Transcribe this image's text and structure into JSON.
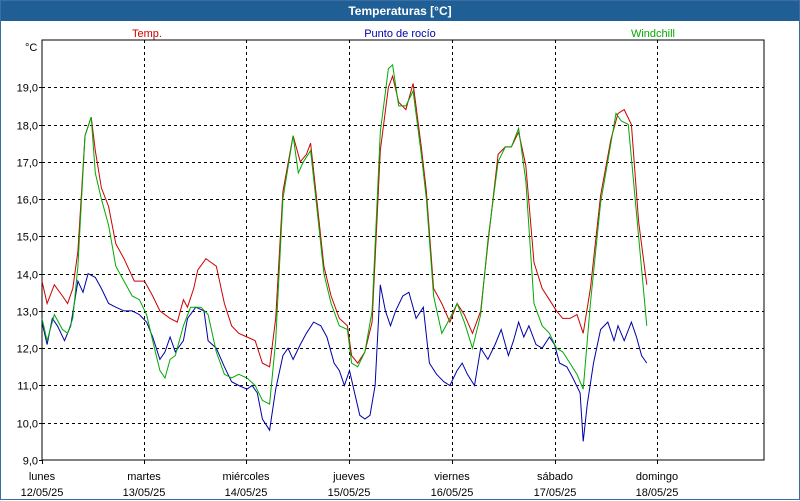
{
  "window": {
    "title": "Temperaturas [°C]"
  },
  "chart_data": {
    "type": "line",
    "title": "Temperaturas [°C]",
    "ylabel": "°C",
    "ylim": [
      9.0,
      20.0
    ],
    "y_ticks": [
      "19,0",
      "18,0",
      "17,0",
      "16,0",
      "15,0",
      "14,0",
      "13,0",
      "12,0",
      "11,0",
      "10,0",
      "9,0"
    ],
    "x_ticks": [
      {
        "day": "lunes",
        "date": "12/05/25"
      },
      {
        "day": "martes",
        "date": "13/05/25"
      },
      {
        "day": "miércoles",
        "date": "14/05/25"
      },
      {
        "day": "jueves",
        "date": "15/05/25"
      },
      {
        "day": "viernes",
        "date": "16/05/25"
      },
      {
        "day": "sábado",
        "date": "17/05/25"
      },
      {
        "day": "domingo",
        "date": "18/05/25"
      }
    ],
    "grid": true,
    "legend_placement": "top",
    "series": [
      {
        "name": "Temp.",
        "color": "#cc0000",
        "points": [
          [
            0.0,
            13.8
          ],
          [
            0.05,
            13.2
          ],
          [
            0.12,
            13.7
          ],
          [
            0.2,
            13.4
          ],
          [
            0.25,
            13.2
          ],
          [
            0.3,
            13.6
          ],
          [
            0.35,
            14.6
          ],
          [
            0.42,
            17.7
          ],
          [
            0.48,
            18.2
          ],
          [
            0.52,
            17.3
          ],
          [
            0.58,
            16.3
          ],
          [
            0.65,
            15.8
          ],
          [
            0.72,
            14.8
          ],
          [
            0.8,
            14.4
          ],
          [
            0.9,
            13.8
          ],
          [
            1.0,
            13.8
          ],
          [
            1.08,
            13.4
          ],
          [
            1.15,
            13.0
          ],
          [
            1.25,
            12.8
          ],
          [
            1.32,
            12.7
          ],
          [
            1.38,
            13.3
          ],
          [
            1.42,
            13.1
          ],
          [
            1.48,
            13.6
          ],
          [
            1.52,
            14.1
          ],
          [
            1.6,
            14.4
          ],
          [
            1.65,
            14.3
          ],
          [
            1.7,
            14.2
          ],
          [
            1.78,
            13.2
          ],
          [
            1.85,
            12.6
          ],
          [
            1.92,
            12.4
          ],
          [
            2.0,
            12.3
          ],
          [
            2.08,
            12.2
          ],
          [
            2.15,
            11.6
          ],
          [
            2.22,
            11.5
          ],
          [
            2.28,
            12.8
          ],
          [
            2.35,
            16.2
          ],
          [
            2.45,
            17.7
          ],
          [
            2.52,
            17.0
          ],
          [
            2.58,
            17.2
          ],
          [
            2.62,
            17.5
          ],
          [
            2.68,
            16.0
          ],
          [
            2.75,
            14.2
          ],
          [
            2.82,
            13.4
          ],
          [
            2.9,
            12.8
          ],
          [
            2.98,
            12.6
          ],
          [
            3.02,
            11.8
          ],
          [
            3.08,
            11.6
          ],
          [
            3.15,
            11.9
          ],
          [
            3.22,
            12.7
          ],
          [
            3.3,
            17.3
          ],
          [
            3.38,
            19.0
          ],
          [
            3.42,
            19.3
          ],
          [
            3.48,
            18.6
          ],
          [
            3.55,
            18.4
          ],
          [
            3.62,
            19.1
          ],
          [
            3.7,
            17.4
          ],
          [
            3.75,
            16.2
          ],
          [
            3.82,
            13.6
          ],
          [
            3.9,
            13.2
          ],
          [
            3.98,
            12.7
          ],
          [
            4.05,
            13.2
          ],
          [
            4.12,
            12.9
          ],
          [
            4.2,
            12.4
          ],
          [
            4.28,
            13.0
          ],
          [
            4.35,
            14.8
          ],
          [
            4.45,
            17.2
          ],
          [
            4.52,
            17.4
          ],
          [
            4.58,
            17.4
          ],
          [
            4.65,
            17.8
          ],
          [
            4.72,
            16.9
          ],
          [
            4.8,
            14.3
          ],
          [
            4.88,
            13.6
          ],
          [
            4.95,
            13.3
          ],
          [
            5.02,
            13.0
          ],
          [
            5.08,
            12.8
          ],
          [
            5.15,
            12.8
          ],
          [
            5.22,
            12.9
          ],
          [
            5.28,
            12.4
          ],
          [
            5.35,
            13.6
          ],
          [
            5.45,
            16.1
          ],
          [
            5.55,
            17.6
          ],
          [
            5.62,
            18.3
          ],
          [
            5.68,
            18.4
          ],
          [
            5.75,
            18.0
          ],
          [
            5.82,
            15.4
          ],
          [
            5.9,
            13.7
          ]
        ]
      },
      {
        "name": "Punto de rocío",
        "color": "#0000aa",
        "points": [
          [
            0.0,
            12.7
          ],
          [
            0.05,
            12.1
          ],
          [
            0.1,
            12.8
          ],
          [
            0.15,
            12.6
          ],
          [
            0.22,
            12.2
          ],
          [
            0.28,
            12.6
          ],
          [
            0.35,
            13.8
          ],
          [
            0.4,
            13.5
          ],
          [
            0.45,
            14.0
          ],
          [
            0.52,
            13.9
          ],
          [
            0.58,
            13.6
          ],
          [
            0.65,
            13.2
          ],
          [
            0.72,
            13.1
          ],
          [
            0.8,
            13.0
          ],
          [
            0.88,
            13.0
          ],
          [
            0.95,
            12.9
          ],
          [
            1.02,
            12.7
          ],
          [
            1.08,
            12.3
          ],
          [
            1.15,
            11.7
          ],
          [
            1.2,
            11.9
          ],
          [
            1.25,
            12.3
          ],
          [
            1.3,
            11.9
          ],
          [
            1.38,
            12.2
          ],
          [
            1.42,
            12.8
          ],
          [
            1.5,
            13.1
          ],
          [
            1.58,
            13.0
          ],
          [
            1.62,
            12.2
          ],
          [
            1.7,
            12.0
          ],
          [
            1.78,
            11.5
          ],
          [
            1.85,
            11.1
          ],
          [
            1.92,
            11.0
          ],
          [
            2.0,
            10.9
          ],
          [
            2.05,
            11.0
          ],
          [
            2.1,
            10.8
          ],
          [
            2.15,
            10.1
          ],
          [
            2.22,
            9.8
          ],
          [
            2.28,
            10.9
          ],
          [
            2.35,
            11.8
          ],
          [
            2.4,
            12.0
          ],
          [
            2.45,
            11.7
          ],
          [
            2.52,
            12.1
          ],
          [
            2.58,
            12.4
          ],
          [
            2.65,
            12.7
          ],
          [
            2.72,
            12.6
          ],
          [
            2.78,
            12.3
          ],
          [
            2.85,
            11.6
          ],
          [
            2.9,
            11.4
          ],
          [
            2.95,
            11.0
          ],
          [
            3.0,
            11.4
          ],
          [
            3.05,
            10.8
          ],
          [
            3.1,
            10.2
          ],
          [
            3.15,
            10.1
          ],
          [
            3.2,
            10.2
          ],
          [
            3.25,
            11.0
          ],
          [
            3.3,
            13.7
          ],
          [
            3.35,
            13.0
          ],
          [
            3.4,
            12.6
          ],
          [
            3.45,
            13.0
          ],
          [
            3.52,
            13.4
          ],
          [
            3.58,
            13.5
          ],
          [
            3.65,
            12.8
          ],
          [
            3.72,
            13.1
          ],
          [
            3.78,
            11.6
          ],
          [
            3.85,
            11.3
          ],
          [
            3.92,
            11.1
          ],
          [
            3.98,
            11.0
          ],
          [
            4.05,
            11.4
          ],
          [
            4.1,
            11.6
          ],
          [
            4.15,
            11.3
          ],
          [
            4.22,
            11.0
          ],
          [
            4.28,
            12.0
          ],
          [
            4.35,
            11.7
          ],
          [
            4.42,
            12.1
          ],
          [
            4.48,
            12.5
          ],
          [
            4.55,
            11.8
          ],
          [
            4.6,
            12.2
          ],
          [
            4.65,
            12.7
          ],
          [
            4.7,
            12.3
          ],
          [
            4.75,
            12.6
          ],
          [
            4.82,
            12.1
          ],
          [
            4.88,
            12.0
          ],
          [
            4.95,
            12.3
          ],
          [
            5.0,
            12.1
          ],
          [
            5.05,
            11.6
          ],
          [
            5.12,
            11.5
          ],
          [
            5.18,
            11.2
          ],
          [
            5.25,
            10.8
          ],
          [
            5.28,
            9.5
          ],
          [
            5.32,
            10.5
          ],
          [
            5.38,
            11.6
          ],
          [
            5.45,
            12.5
          ],
          [
            5.52,
            12.7
          ],
          [
            5.58,
            12.2
          ],
          [
            5.62,
            12.6
          ],
          [
            5.68,
            12.2
          ],
          [
            5.75,
            12.7
          ],
          [
            5.8,
            12.3
          ],
          [
            5.85,
            11.8
          ],
          [
            5.9,
            11.6
          ]
        ]
      },
      {
        "name": "Windchill",
        "color": "#00aa00",
        "points": [
          [
            0.0,
            12.8
          ],
          [
            0.05,
            12.2
          ],
          [
            0.12,
            12.9
          ],
          [
            0.2,
            12.5
          ],
          [
            0.25,
            12.4
          ],
          [
            0.3,
            12.8
          ],
          [
            0.35,
            14.2
          ],
          [
            0.42,
            17.7
          ],
          [
            0.48,
            18.2
          ],
          [
            0.52,
            16.7
          ],
          [
            0.58,
            16.0
          ],
          [
            0.65,
            15.3
          ],
          [
            0.72,
            14.2
          ],
          [
            0.8,
            13.8
          ],
          [
            0.88,
            13.4
          ],
          [
            0.95,
            13.3
          ],
          [
            1.02,
            12.9
          ],
          [
            1.08,
            12.2
          ],
          [
            1.15,
            11.4
          ],
          [
            1.2,
            11.2
          ],
          [
            1.25,
            11.7
          ],
          [
            1.3,
            11.8
          ],
          [
            1.38,
            12.6
          ],
          [
            1.45,
            13.1
          ],
          [
            1.55,
            13.1
          ],
          [
            1.62,
            12.9
          ],
          [
            1.7,
            11.9
          ],
          [
            1.78,
            11.3
          ],
          [
            1.85,
            11.2
          ],
          [
            1.92,
            11.3
          ],
          [
            2.0,
            11.2
          ],
          [
            2.08,
            11.0
          ],
          [
            2.15,
            10.6
          ],
          [
            2.22,
            10.5
          ],
          [
            2.28,
            12.2
          ],
          [
            2.35,
            16.0
          ],
          [
            2.45,
            17.7
          ],
          [
            2.5,
            16.7
          ],
          [
            2.55,
            17.0
          ],
          [
            2.62,
            17.3
          ],
          [
            2.68,
            15.8
          ],
          [
            2.75,
            14.0
          ],
          [
            2.82,
            13.2
          ],
          [
            2.9,
            12.6
          ],
          [
            2.98,
            12.5
          ],
          [
            3.02,
            11.6
          ],
          [
            3.08,
            11.5
          ],
          [
            3.15,
            11.9
          ],
          [
            3.22,
            13.0
          ],
          [
            3.3,
            17.8
          ],
          [
            3.38,
            19.5
          ],
          [
            3.42,
            19.6
          ],
          [
            3.48,
            18.5
          ],
          [
            3.55,
            18.5
          ],
          [
            3.62,
            18.9
          ],
          [
            3.7,
            17.2
          ],
          [
            3.75,
            16.0
          ],
          [
            3.82,
            13.4
          ],
          [
            3.9,
            12.4
          ],
          [
            3.98,
            12.8
          ],
          [
            4.05,
            13.2
          ],
          [
            4.12,
            12.7
          ],
          [
            4.2,
            12.0
          ],
          [
            4.28,
            12.9
          ],
          [
            4.35,
            14.9
          ],
          [
            4.45,
            17.0
          ],
          [
            4.52,
            17.4
          ],
          [
            4.58,
            17.4
          ],
          [
            4.65,
            17.9
          ],
          [
            4.72,
            16.5
          ],
          [
            4.8,
            13.2
          ],
          [
            4.88,
            12.6
          ],
          [
            4.95,
            12.4
          ],
          [
            5.02,
            12.0
          ],
          [
            5.08,
            11.9
          ],
          [
            5.15,
            11.6
          ],
          [
            5.22,
            11.3
          ],
          [
            5.28,
            10.9
          ],
          [
            5.35,
            13.2
          ],
          [
            5.45,
            15.9
          ],
          [
            5.55,
            17.5
          ],
          [
            5.6,
            18.3
          ],
          [
            5.65,
            18.1
          ],
          [
            5.72,
            18.0
          ],
          [
            5.82,
            15.0
          ],
          [
            5.9,
            12.6
          ]
        ]
      }
    ]
  }
}
